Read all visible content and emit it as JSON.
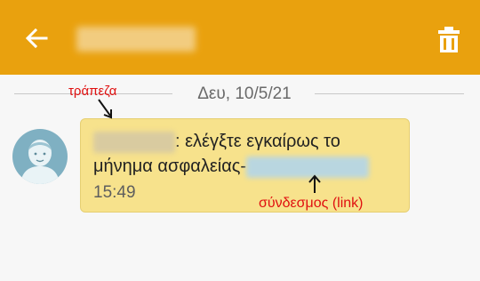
{
  "appbar": {
    "background": "#e9a10e",
    "back_icon": "arrow-left-icon",
    "delete_icon": "trash-icon"
  },
  "conversation": {
    "date_separator": "Δευ, 10/5/21"
  },
  "message": {
    "text": ": ελέγξτε εγκαίρως το μήνημα ασφαλείας-",
    "time": "15:49",
    "bubble_color": "#f7e28c"
  },
  "annotations": {
    "bank_label": "τράπεζα",
    "link_label": "σύνδεσμος (link)",
    "color": "#e01010"
  }
}
